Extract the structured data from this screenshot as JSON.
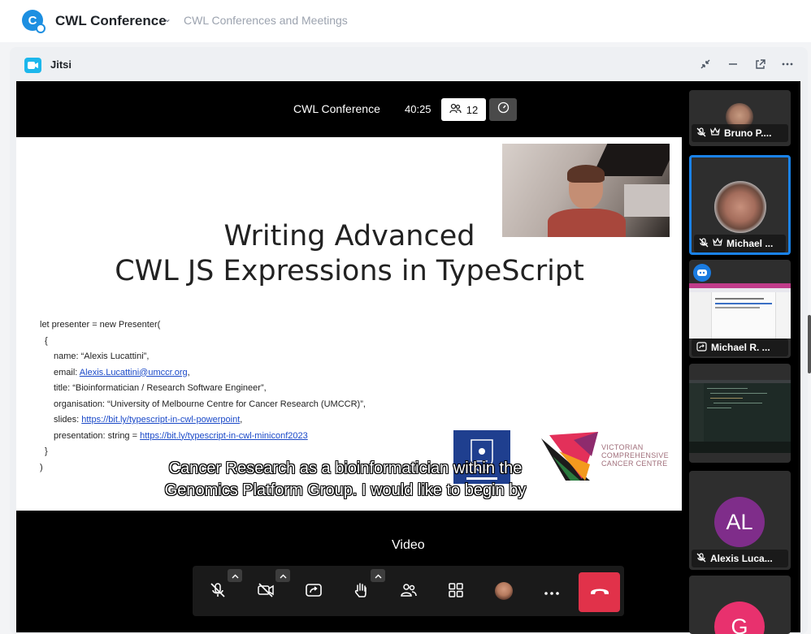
{
  "app": {
    "title": "CWL Conference",
    "subtitle": "CWL Conferences and Meetings"
  },
  "card": {
    "title": "Jitsi"
  },
  "meeting": {
    "title": "CWL Conference",
    "timer": "40:25",
    "participant_count": "12",
    "video_label": "Video"
  },
  "slide": {
    "title_line1": "Writing Advanced",
    "title_line2": "CWL JS Expressions in TypeScript",
    "code": {
      "line1": "let presenter = new Presenter(",
      "line2": "{",
      "name": "name: “Alexis Lucattini”,",
      "email_prefix": "email: ",
      "email_link": "Alexis.Lucattini@umccr.org",
      "email_suffix": ",",
      "title": "title: “Bioinformatician / Research Software Engineer”,",
      "organisation": "organisation: “University of Melbourne Centre for Cancer Research (UMCCR)”,",
      "slides_prefix": "slides: ",
      "slides_link": "https://bit.ly/typescript-in-cwl-powerpoint",
      "slides_suffix": ",",
      "presentation_prefix": "presentation: string = ",
      "presentation_link": "https://bit.ly/typescript-in-cwl-miniconf2023",
      "close_brace": "}",
      "close_paren": ")"
    },
    "vccc_text": [
      "VICTORIAN",
      "COMPREHENSIVE",
      "CANCER CENTRE"
    ]
  },
  "caption": {
    "line1": "Cancer Research as a bioinformatician within the",
    "line2": "Genomics Platform Group. I would like to begin by"
  },
  "participants": [
    {
      "name": "Bruno P...."
    },
    {
      "name": "Michael ..."
    },
    {
      "name": "Michael R. ..."
    },
    {
      "name": ""
    },
    {
      "initials": "AL",
      "name": "Alexis Luca..."
    },
    {
      "initials": "G",
      "name": ""
    }
  ],
  "colors": {
    "brand_blue": "#1d8fe1",
    "jitsi_blue": "#1cb7ec",
    "hangup_red": "#e1324a",
    "active_tile_border": "#1a82e8",
    "avatar_al": "#7f2d8a",
    "avatar_g": "#e8316e"
  },
  "icons": {
    "toolbar": [
      "microphone-muted-icon",
      "camera-muted-icon",
      "screen-share-icon",
      "raise-hand-icon",
      "participants-icon",
      "tile-view-icon",
      "avatar",
      "more-icon",
      "hangup-icon"
    ]
  }
}
